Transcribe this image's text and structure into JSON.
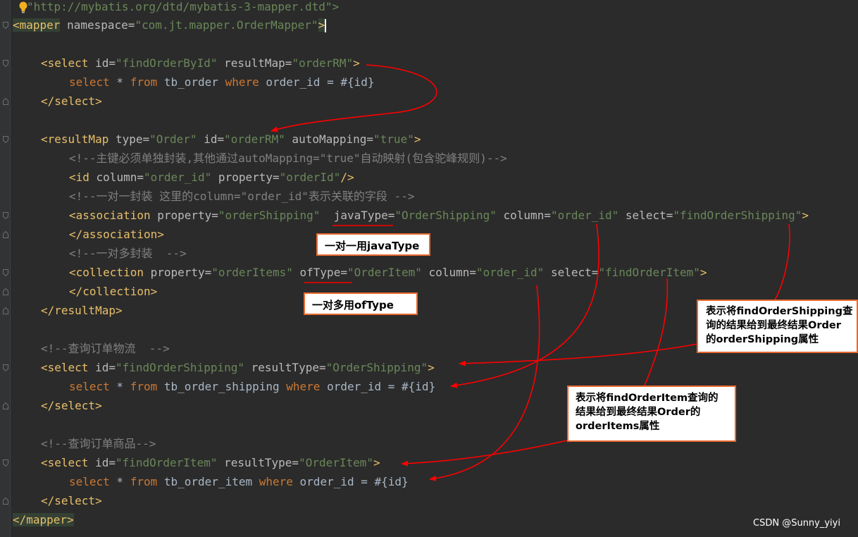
{
  "code": {
    "l1_dtd": "\"http://mybatis.org/dtd/mybatis-3-mapper.dtd\">",
    "l2_open": "<mapper",
    "l2_attr": " namespace=",
    "l2_val": "\"com.jt.mapper.OrderMapper\"",
    "l2_close": ">",
    "l4_open": "<select",
    "l4_a1": " id=",
    "l4_v1": "\"findOrderById\"",
    "l4_a2": " resultMap=",
    "l4_v2": "\"orderRM\"",
    "l4_close": ">",
    "l5_kw1": "select",
    "l5_t1": " * ",
    "l5_kw2": "from",
    "l5_t2": " tb_order ",
    "l5_kw3": "where",
    "l5_t3": " order_id = #{id}",
    "l6": "</select>",
    "l8_open": "<resultMap",
    "l8_a1": " type=",
    "l8_v1": "\"Order\"",
    "l8_a2": " id=",
    "l8_v2": "\"orderRM\"",
    "l8_a3": " autoMapping=",
    "l8_v3": "\"true\"",
    "l8_close": ">",
    "l9": "<!--主键必须单独封装,其他通过autoMapping=\"true\"自动映射(包含驼峰规则)-->",
    "l10_open": "<id",
    "l10_a1": " column=",
    "l10_v1": "\"order_id\"",
    "l10_a2": " property=",
    "l10_v2": "\"orderId\"",
    "l10_close": "/>",
    "l11": "<!--一对一封装 这里的column=\"order_id\"表示关联的字段 -->",
    "l12_open": "<association",
    "l12_a1": " property=",
    "l12_v1": "\"orderShipping\"",
    "l12_a2": "  javaType=",
    "l12_v2": "\"OrderShipping\"",
    "l12_a3": " column=",
    "l12_v3": "\"order_id\"",
    "l12_a4": " select=",
    "l12_v4": "\"findOrderShipping\"",
    "l12_close": ">",
    "l13": "</association>",
    "l14": "<!--一对多封装  -->",
    "l15_open": "<collection",
    "l15_a1": " property=",
    "l15_v1": "\"orderItems\"",
    "l15_a2": " ofType=",
    "l15_v2": "\"OrderItem\"",
    "l15_a3": " column=",
    "l15_v3": "\"order_id\"",
    "l15_a4": " select=",
    "l15_v4": "\"findOrderItem\"",
    "l15_close": ">",
    "l16": "</collection>",
    "l17": "</resultMap>",
    "l19": "<!--查询订单物流  -->",
    "l20_open": "<select",
    "l20_a1": " id=",
    "l20_v1": "\"findOrderShipping\"",
    "l20_a2": " resultType=",
    "l20_v2": "\"OrderShipping\"",
    "l20_close": ">",
    "l21_kw1": "select",
    "l21_t1": " * ",
    "l21_kw2": "from",
    "l21_t2": " tb_order_shipping ",
    "l21_kw3": "where",
    "l21_t3": " order_id = #{id}",
    "l22": "</select>",
    "l24": "<!--查询订单商品-->",
    "l25_open": "<select",
    "l25_a1": " id=",
    "l25_v1": "\"findOrderItem\"",
    "l25_a2": " resultType=",
    "l25_v2": "\"OrderItem\"",
    "l25_close": ">",
    "l26_kw1": "select",
    "l26_t1": " * ",
    "l26_kw2": "from",
    "l26_t2": " tb_order_item ",
    "l26_kw3": "where",
    "l26_t3": " order_id = #{id}",
    "l27": "</select>",
    "l28": "</mapper>"
  },
  "annotations": {
    "one_to_one": "一对一用javaType",
    "one_to_many": "一对多用ofType",
    "shipping_note_1": "表示将findOrderShipping查",
    "shipping_note_2": "询的结果给到最终结果Order",
    "shipping_note_3": "的orderShipping属性",
    "item_note_1": "表示将findOrderItem查询的",
    "item_note_2": "结果给到最终结果Order的",
    "item_note_3": "orderItems属性"
  },
  "watermark": "CSDN @Sunny_yiyi",
  "colors": {
    "background": "#2b2b2b",
    "tag": "#e8bf6a",
    "attribute": "#bababa",
    "value": "#6a8759",
    "comment": "#808080",
    "keyword": "#cc7832",
    "arrow": "#ff0000",
    "box_border": "#e8692e"
  },
  "icons": [
    "lightbulb-icon",
    "fold-marker-icon"
  ]
}
